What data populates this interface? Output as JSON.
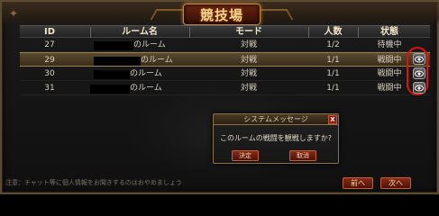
{
  "window": {
    "title": "競技場"
  },
  "table": {
    "headers": [
      "ID",
      "ルーム名",
      "モード",
      "人数",
      "状態"
    ],
    "rows": [
      {
        "id": "27",
        "room_name": "のルーム",
        "mode": "対戦",
        "players": "1/2",
        "status": "待機中",
        "selected": false,
        "watch": false
      },
      {
        "id": "29",
        "room_name": "のルーム",
        "mode": "対戦",
        "players": "1/1",
        "status": "戦闘中",
        "selected": true,
        "watch": true
      },
      {
        "id": "30",
        "room_name": "のルーム",
        "mode": "対戦",
        "players": "1/1",
        "status": "戦闘中",
        "selected": false,
        "watch": true
      },
      {
        "id": "31",
        "room_name": "のルーム",
        "mode": "対戦",
        "players": "1/1",
        "status": "戦闘中",
        "selected": false,
        "watch": true
      }
    ]
  },
  "dialog": {
    "title": "システムメッセージ",
    "close_label": "X",
    "message": "このルームの戦闘を観戦しますか?",
    "ok_label": "決定",
    "cancel_label": "取消"
  },
  "footer": {
    "note": "注意：チャット等に個人情報をお聞きするのはおやめましょう",
    "prev_label": "前へ",
    "next_label": "次へ"
  },
  "colors": {
    "highlight": "#e01010",
    "accent": "#c0603a",
    "title_gold": "#f3d38a"
  },
  "icons": {
    "watch": "eye-icon",
    "close": "close-icon"
  }
}
